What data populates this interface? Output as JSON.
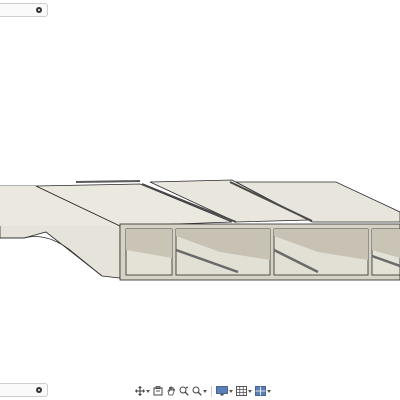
{
  "viewer": {
    "model_icon": "extruded-channel-body",
    "colors": {
      "face_light": "#ebe8df",
      "face_mid": "#d6d2c6",
      "face_dark": "#bdb8aa",
      "edge": "#2b2b2b",
      "rib_dark": "#6a6a6a"
    }
  },
  "top_left_control": {
    "icon": "browser-toggle-dot"
  },
  "bottom_left_control": {
    "icon": "comments-toggle-dot"
  },
  "navigation_toolbar": {
    "tools": [
      {
        "icon": "orbit-icon",
        "has_menu": true
      },
      {
        "icon": "look-at-icon",
        "has_menu": false
      },
      {
        "icon": "pan-hand-icon",
        "has_menu": false
      },
      {
        "icon": "zoom-icon",
        "has_menu": false
      },
      {
        "icon": "fit-zoom-icon",
        "has_menu": true
      },
      {
        "icon": "display-settings-icon",
        "has_menu": true
      },
      {
        "icon": "grid-snaps-icon",
        "has_menu": true
      },
      {
        "icon": "viewports-icon",
        "has_menu": true
      }
    ]
  }
}
